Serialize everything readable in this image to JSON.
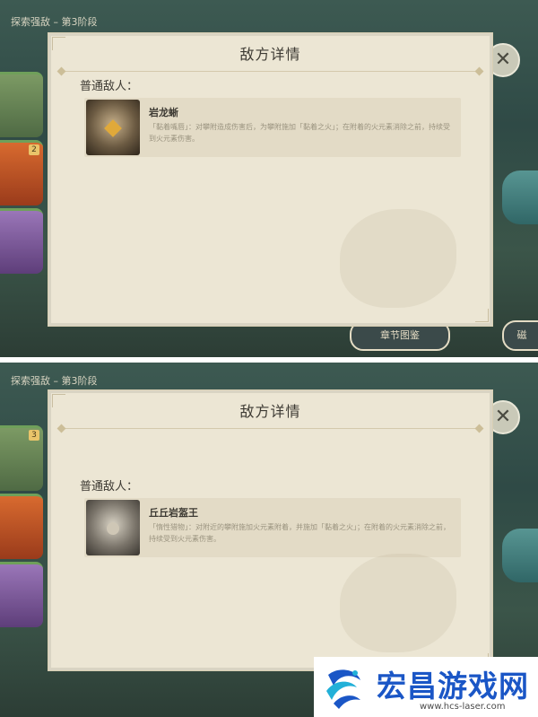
{
  "panels": [
    {
      "header": "探索强敌 – 第3阶段",
      "dialog_title": "敌方详情",
      "section_label": "普通敌人：",
      "enemy_name": "岩龙蜥",
      "enemy_desc": "「黏着嘴唇」：对攀附造成伤害后，为攀附施加「黏着之火」；在附着的火元素消除之前，持续受到火元素伤害。",
      "close_label": "✕",
      "bottom_button": "章节图鉴",
      "bottom_button_right": "磁"
    },
    {
      "header": "探索强敌 – 第3阶段",
      "dialog_title": "敌方详情",
      "section_label": "普通敌人：",
      "enemy_name": "丘丘岩盔王",
      "enemy_desc": "「惰性猎物」：对附近的攀附施加火元素附着，并施加「黏着之火」；在附着的火元素消除之前，持续受到火元素伤害。",
      "close_label": "✕",
      "side_badge": "3"
    }
  ],
  "side_badge_top": "2",
  "banner": {
    "title": "宏昌游戏网",
    "url": "www.hcs-laser.com",
    "color": "#1a56c6"
  }
}
